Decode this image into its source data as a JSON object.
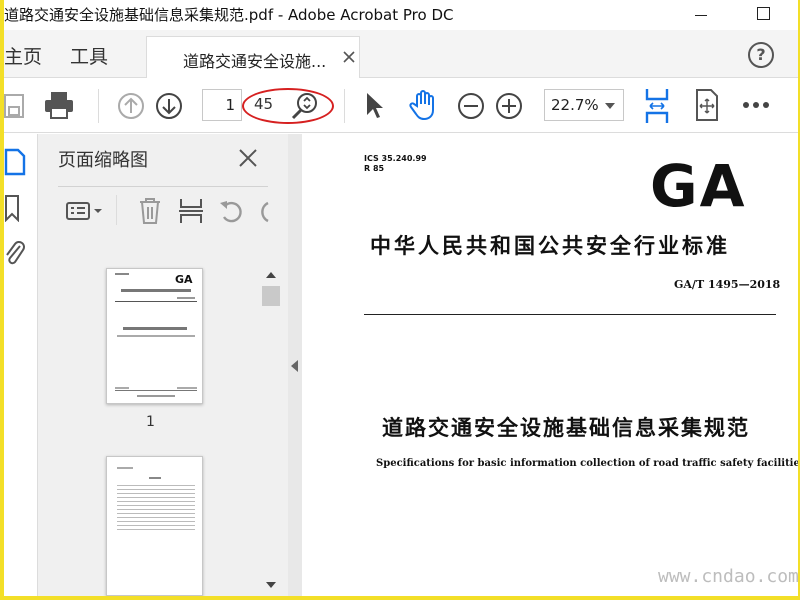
{
  "window": {
    "title": "道路交通安全设施基础信息采集规范.pdf - Adobe Acrobat Pro DC"
  },
  "tabs": {
    "home": "主页",
    "tools": "工具",
    "document": "道路交通安全设施..."
  },
  "toolbar": {
    "current_page": "1",
    "total_pages": "45",
    "zoom": "22.7%"
  },
  "panel": {
    "title": "页面缩略图",
    "thumbnail_1_label": "1"
  },
  "document": {
    "ics_line1": "ICS 35.240.99",
    "ics_line2": "R 85",
    "logo": "GA",
    "standard_name_cn": "中华人民共和国公共安全行业标准",
    "standard_number": "GA/T 1495—2018",
    "title_cn": "道路交通安全设施基础信息采集规范",
    "title_en": "Specifications for basic information collection of road traffic safety facilities"
  },
  "watermark": "www.cndao.com",
  "annotation": {
    "highlight_color": "#d62020"
  },
  "colors": {
    "toolbar_icon_blue": "#1473e6",
    "icon_gray": "#555555"
  }
}
